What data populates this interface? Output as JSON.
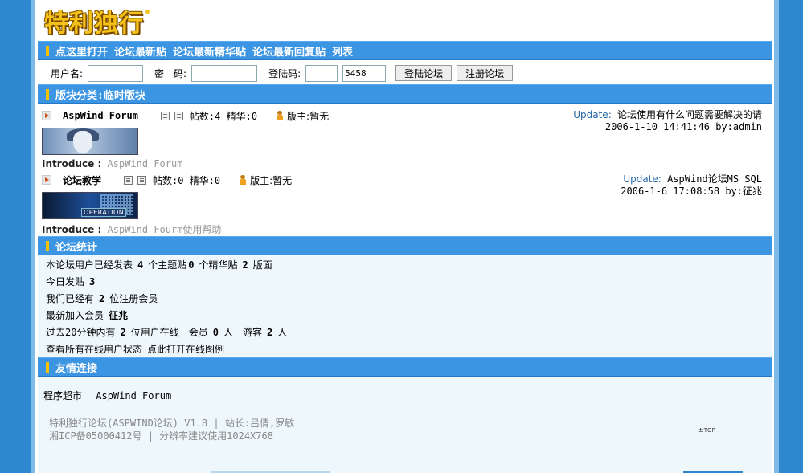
{
  "logo": {
    "text": "特利独行"
  },
  "nav": {
    "links": [
      "点这里打开",
      "论坛最新贴",
      "论坛最新精华贴",
      "论坛最新回复贴",
      "列表"
    ]
  },
  "login": {
    "username_label": "用户名:",
    "password_label": "密　码:",
    "code_label": "登陆码:",
    "username_value": "",
    "password_value": "",
    "code_value": "",
    "code_display": "5458",
    "login_button": "登陆论坛",
    "register_button": "注册论坛"
  },
  "category": {
    "title": "版块分类:临时版块"
  },
  "forums": [
    {
      "name": "AspWind Forum",
      "stats": "帖数:4 精华:0",
      "moderator": "版主:暂无",
      "update_label": "Update:",
      "update_title": "论坛使用有什么问题需要解决的请",
      "update_meta": "2006-1-10 14:41:46 by:admin",
      "intro_label": "Introduce :",
      "intro_value": "AspWind Forum"
    },
    {
      "name": "论坛教学",
      "stats": "帖数:0 精华:0",
      "moderator": "版主:暂无",
      "update_label": "Update:",
      "update_title": "AspWind论坛MS SQL",
      "update_meta": "2006-1-6 17:08:58 by:征兆",
      "intro_label": "Introduce :",
      "intro_value": "AspWind Fourm使用帮助",
      "thumb_tag": "OPERATION"
    }
  ],
  "stats_section": {
    "title": "论坛统计",
    "line1": {
      "a": "本论坛用户已经发表",
      "n1": "4",
      "b": "个主题贴",
      "n2": "0",
      "c": "个精华贴",
      "n3": "2",
      "d": "版面"
    },
    "line2": {
      "a": "今日发贴",
      "n1": "3"
    },
    "line3": {
      "a": "我们已经有",
      "n1": "2",
      "b": "位注册会员"
    },
    "line4": {
      "a": "最新加入会员",
      "n1": "征兆"
    },
    "line5": {
      "a": "过去20分钟内有",
      "n1": "2",
      "b": "位用户在线　会员",
      "n2": "0",
      "c": "人　游客",
      "n3": "2",
      "d": "人"
    },
    "line6": {
      "a": "查看所有在线用户状态",
      "link": "点此打开在线图例"
    }
  },
  "friend_links": {
    "title": "友情连接",
    "items": [
      "程序超市",
      "AspWind Forum"
    ]
  },
  "footer": {
    "line1": "特利独行论坛(ASPWIND论坛) V1.8 | 站长:吕倩,罗敏",
    "line2": "湘ICP备05000412号 |  分辨率建议使用1024X768",
    "top": "TOP"
  },
  "colors": {
    "bar": "#3b95e3",
    "edge": "#2f88cf",
    "panel": "#eef8fc",
    "accent": "#f4c300"
  }
}
